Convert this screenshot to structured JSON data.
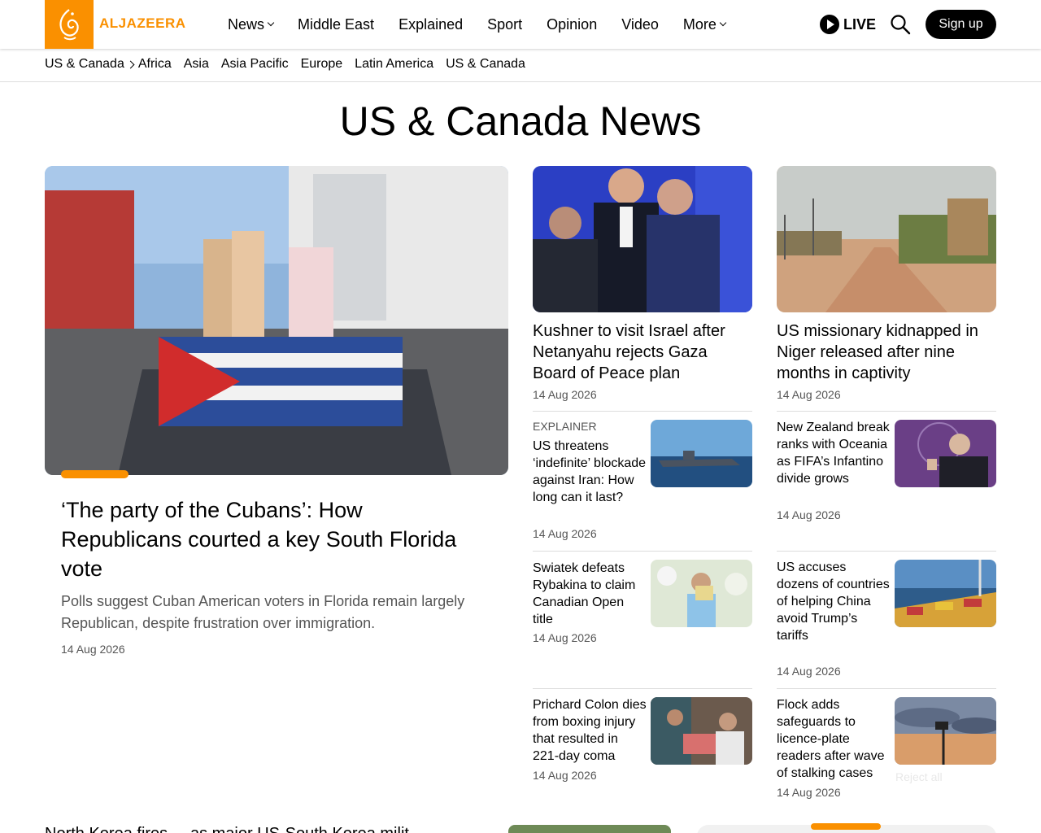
{
  "brand": {
    "name": "ALJAZEERA",
    "accent": "#fa9000"
  },
  "nav": {
    "items": [
      {
        "label": "News",
        "has_menu": true
      },
      {
        "label": "Middle East",
        "has_menu": false
      },
      {
        "label": "Explained",
        "has_menu": false
      },
      {
        "label": "Sport",
        "has_menu": false
      },
      {
        "label": "Opinion",
        "has_menu": false
      },
      {
        "label": "Video",
        "has_menu": false
      },
      {
        "label": "More",
        "has_menu": true
      }
    ],
    "live_label": "LIVE",
    "signup_label": "Sign up"
  },
  "subnav": {
    "current": "US & Canada",
    "items": [
      "Africa",
      "Asia",
      "Asia Pacific",
      "Europe",
      "Latin America",
      "US & Canada"
    ]
  },
  "page_title": "US & Canada News",
  "featured": {
    "title": "‘The party of the Cubans’: How Republicans courted a key South Florida vote",
    "summary": "Polls suggest Cuban American voters in Florida remain largely Republican, despite frustration over immigration.",
    "date": "14 Aug 2026"
  },
  "top_cards": [
    {
      "title": "Kushner to visit Israel after Netanyahu rejects Gaza Board of Peace plan",
      "date": "14 Aug 2026"
    },
    {
      "title": "US missionary kidnapped in Niger released after nine months in captivity",
      "date": "14 Aug 2026"
    }
  ],
  "list_left": [
    {
      "tag": "EXPLAINER",
      "title": "US threatens ‘indefinite’ blockade against Iran: How long can it last?",
      "date": "14 Aug 2026"
    },
    {
      "tag": "",
      "title": "Swiatek defeats Rybakina to claim Canadian Open title",
      "date": "14 Aug 2026"
    },
    {
      "tag": "",
      "title": "Prichard Colon dies from boxing injury that resulted in 221-day coma",
      "date": "14 Aug 2026"
    }
  ],
  "list_right": [
    {
      "tag": "",
      "title": "New Zealand break ranks with Oceania as FIFA’s Infantino divide grows",
      "date": "14 Aug 2026"
    },
    {
      "tag": "",
      "title": "US accuses dozens of countries of helping China avoid Trump’s tariffs",
      "date": "14 Aug 2026"
    },
    {
      "tag": "",
      "title": "Flock adds safeguards to licence-plate readers after wave of stalking cases",
      "date": "14 Aug 2026"
    }
  ],
  "ghost_text": "Reject all",
  "bottom_partial": "North Korea fires ... as major US-South Korea milit..."
}
